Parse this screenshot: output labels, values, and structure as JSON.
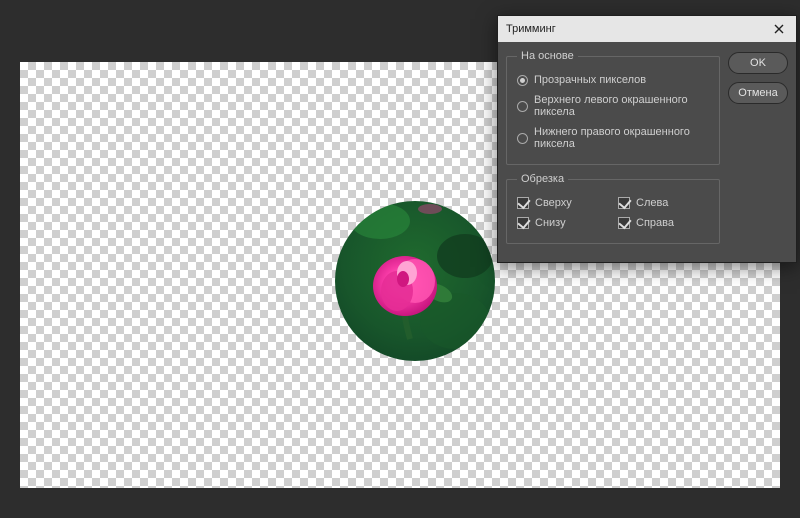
{
  "dialog": {
    "title": "Тримминг",
    "close_aria": "Закрыть",
    "groups": {
      "based_on": {
        "legend": "На основе",
        "options": [
          {
            "label": "Прозрачных пикселов",
            "checked": true
          },
          {
            "label": "Верхнего левого окрашенного пиксела",
            "checked": false
          },
          {
            "label": "Нижнего правого окрашенного пиксела",
            "checked": false
          }
        ]
      },
      "trim_away": {
        "legend": "Обрезка",
        "options": [
          {
            "label": "Сверху",
            "checked": true
          },
          {
            "label": "Слева",
            "checked": true
          },
          {
            "label": "Снизу",
            "checked": true
          },
          {
            "label": "Справа",
            "checked": true
          }
        ]
      }
    },
    "buttons": {
      "ok": "OK",
      "cancel": "Отмена"
    }
  }
}
